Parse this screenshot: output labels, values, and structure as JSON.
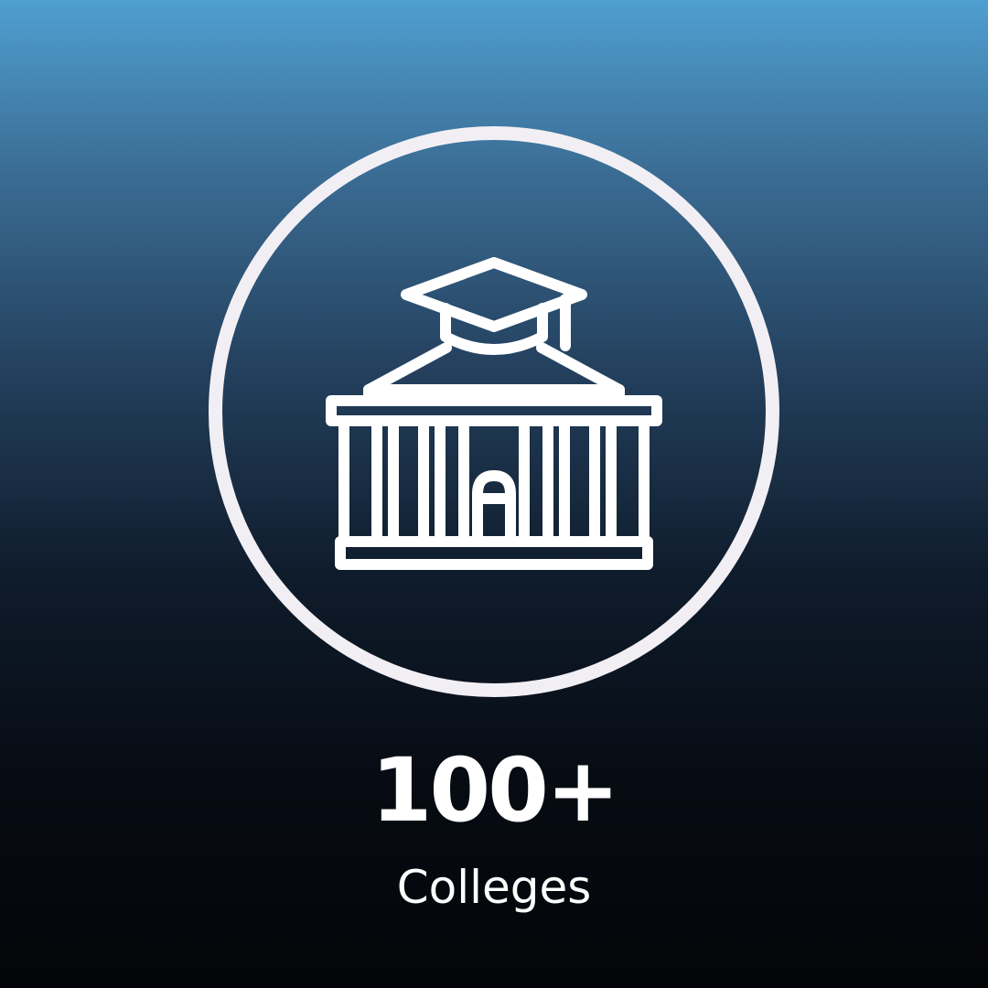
{
  "stat": {
    "value": "100+",
    "label": "Colleges"
  },
  "icon": {
    "name": "college-building-graduation-cap-icon",
    "stroke_color": "#ffffff"
  },
  "colors": {
    "gradient_top": "#4f9fd1",
    "gradient_bottom": "#030508",
    "ring": "#f2eff4",
    "text": "#ffffff"
  }
}
